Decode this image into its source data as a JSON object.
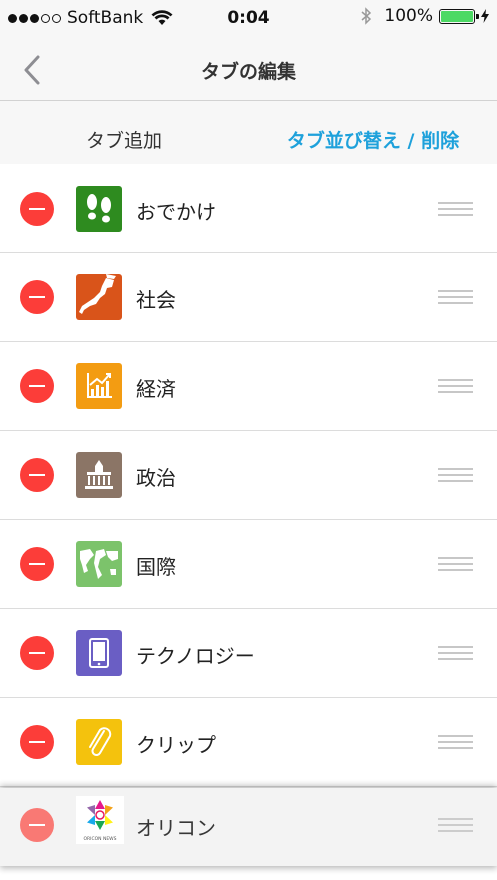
{
  "status_bar": {
    "carrier": "SoftBank",
    "time": "0:04",
    "battery_percent": "100%",
    "battery_level": 1.0,
    "signal_bars": 3,
    "signal_total": 5
  },
  "nav": {
    "title": "タブの編集",
    "back_icon": "chevron-left-icon"
  },
  "tabs": [
    {
      "label": "タブ追加",
      "active": false
    },
    {
      "label": "タブ並び替え / 削除",
      "active": true
    }
  ],
  "colors": {
    "accent": "#1ea1db",
    "delete": "#fc3d39",
    "battery": "#4cd964"
  },
  "items": [
    {
      "label": "おでかけ",
      "icon": "footprints-icon",
      "color": "#2e8b1f"
    },
    {
      "label": "社会",
      "icon": "japan-map-icon",
      "color": "#d9541a"
    },
    {
      "label": "経済",
      "icon": "growth-chart-icon",
      "color": "#f39c12"
    },
    {
      "label": "政治",
      "icon": "diet-building-icon",
      "color": "#8b7566"
    },
    {
      "label": "国際",
      "icon": "world-map-icon",
      "color": "#7cc36b"
    },
    {
      "label": "テクノロジー",
      "icon": "tablet-icon",
      "color": "#6a5ec4"
    },
    {
      "label": "クリップ",
      "icon": "paperclip-icon",
      "color": "#f4c20d"
    }
  ],
  "dragging_item": {
    "label": "オリコン",
    "icon": "oricon-news-logo",
    "logo_text": "ORICON NEWS"
  }
}
